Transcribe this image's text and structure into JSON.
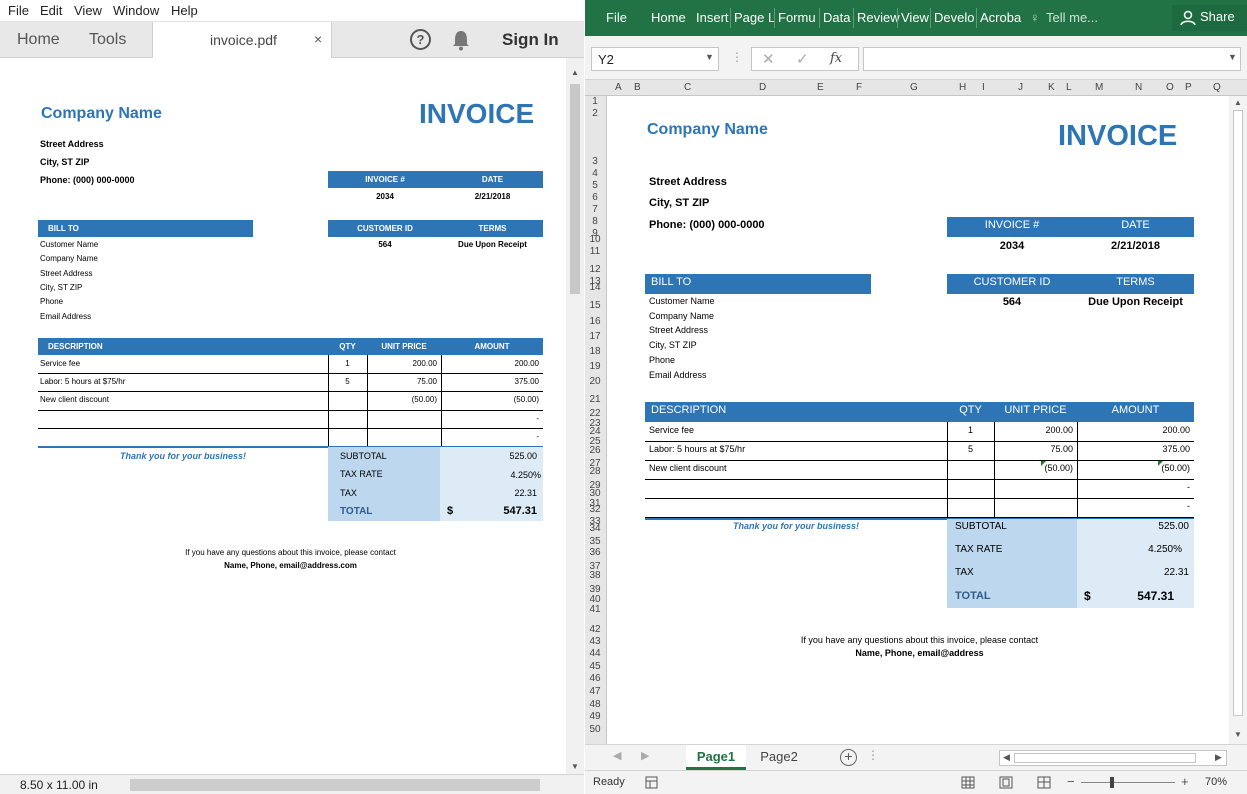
{
  "pdf": {
    "menu": [
      "File",
      "Edit",
      "View",
      "Window",
      "Help"
    ],
    "nav": {
      "home": "Home",
      "tools": "Tools"
    },
    "tab": {
      "title": "invoice.pdf",
      "close": "×"
    },
    "help": "?",
    "signin": "Sign In",
    "page_size": "8.50 x 11.00 in"
  },
  "excel": {
    "ribbon_tabs": [
      "File",
      "Home",
      "Insert",
      "Page L",
      "Formu",
      "Data",
      "Review",
      "View",
      "Develo",
      "Acroba"
    ],
    "tell_me": "Tell me...",
    "share": "Share",
    "name_box": "Y2",
    "fx": "fx",
    "col_headers": [
      "A",
      "B",
      "C",
      "D",
      "E",
      "F",
      "G",
      "H",
      "I",
      "J",
      "K",
      "L",
      "M",
      "N",
      "O",
      "P",
      "Q"
    ],
    "row_headers": [
      "1",
      "2",
      "3",
      "4",
      "5",
      "6",
      "7",
      "8",
      "9",
      "10",
      "11",
      "12",
      "13",
      "14",
      "15",
      "16",
      "17",
      "18",
      "19",
      "20",
      "21",
      "22",
      "23",
      "24",
      "25",
      "26",
      "27",
      "28",
      "29",
      "30",
      "31",
      "32",
      "33",
      "34",
      "35",
      "36",
      "37",
      "38",
      "39",
      "40",
      "41",
      "42",
      "43",
      "44",
      "45",
      "46",
      "47",
      "48",
      "49",
      "50"
    ],
    "sheets": [
      "Page1",
      "Page2"
    ],
    "status": "Ready",
    "zoom": "70%"
  },
  "invoice": {
    "company": "Company Name",
    "title": "INVOICE",
    "street": "Street Address",
    "city": "City, ST  ZIP",
    "phone": "Phone: (000) 000-0000",
    "labels": {
      "invoice_no": "INVOICE #",
      "date": "DATE",
      "bill_to": "BILL TO",
      "customer_id": "CUSTOMER ID",
      "terms": "TERMS",
      "description": "DESCRIPTION",
      "qty": "QTY",
      "unit_price": "UNIT PRICE",
      "amount": "AMOUNT",
      "subtotal": "SUBTOTAL",
      "tax_rate": "TAX RATE",
      "tax": "TAX",
      "total": "TOTAL"
    },
    "invoice_no": "2034",
    "date": "2/21/2018",
    "customer_id": "564",
    "terms": "Due Upon Receipt",
    "bill_to": [
      "Customer Name",
      "Company Name",
      "Street Address",
      "City, ST  ZIP",
      "Phone",
      "Email Address"
    ],
    "items": [
      {
        "desc": "Service fee",
        "qty": "1",
        "price": "200.00",
        "amount": "200.00"
      },
      {
        "desc": "Labor: 5 hours at $75/hr",
        "qty": "5",
        "price": "75.00",
        "amount": "375.00"
      },
      {
        "desc": "New client discount",
        "qty": "",
        "price": "(50.00)",
        "amount": "(50.00)"
      },
      {
        "desc": "",
        "qty": "",
        "price": "",
        "amount": "-"
      },
      {
        "desc": "",
        "qty": "",
        "price": "",
        "amount": "-"
      }
    ],
    "thanks": "Thank you for your business!",
    "subtotal": "525.00",
    "tax_rate": "4.250%",
    "tax": "22.31",
    "currency": "$",
    "total": "547.31",
    "footer1": "If you have any questions about this invoice, please contact",
    "footer2_pdf": "Name, Phone, email@address.com",
    "footer2_xl": "Name, Phone, email@address"
  }
}
